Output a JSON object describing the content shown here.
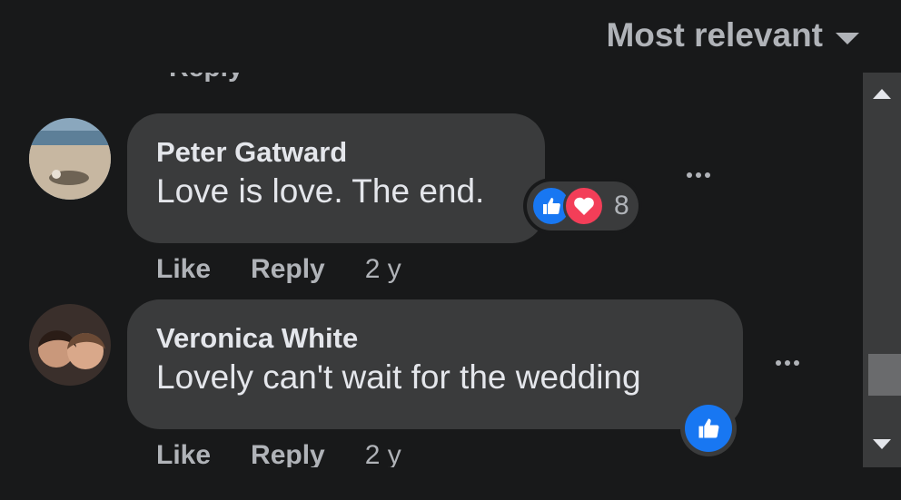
{
  "sort": {
    "label": "Most relevant"
  },
  "hidden_previous": {
    "label": "Reply"
  },
  "comments": [
    {
      "author": "Peter Gatward",
      "text": "Love is love. The end.",
      "actions": {
        "like": "Like",
        "reply": "Reply",
        "time": "2 y"
      },
      "reactions": {
        "types": [
          "like-icon",
          "love-icon"
        ],
        "count": "8"
      }
    },
    {
      "author": "Veronica White",
      "text": "Lovely can't wait for the wedding",
      "actions": {
        "like": "Like",
        "reply": "Reply",
        "time": "2 y"
      },
      "reactions": {
        "types": [
          "like-icon"
        ]
      }
    }
  ],
  "colors": {
    "background": "#18191a",
    "bubble": "#3a3b3c",
    "like_blue": "#1877f2",
    "love_red": "#f33e58",
    "secondary_text": "#b0b3b8"
  }
}
